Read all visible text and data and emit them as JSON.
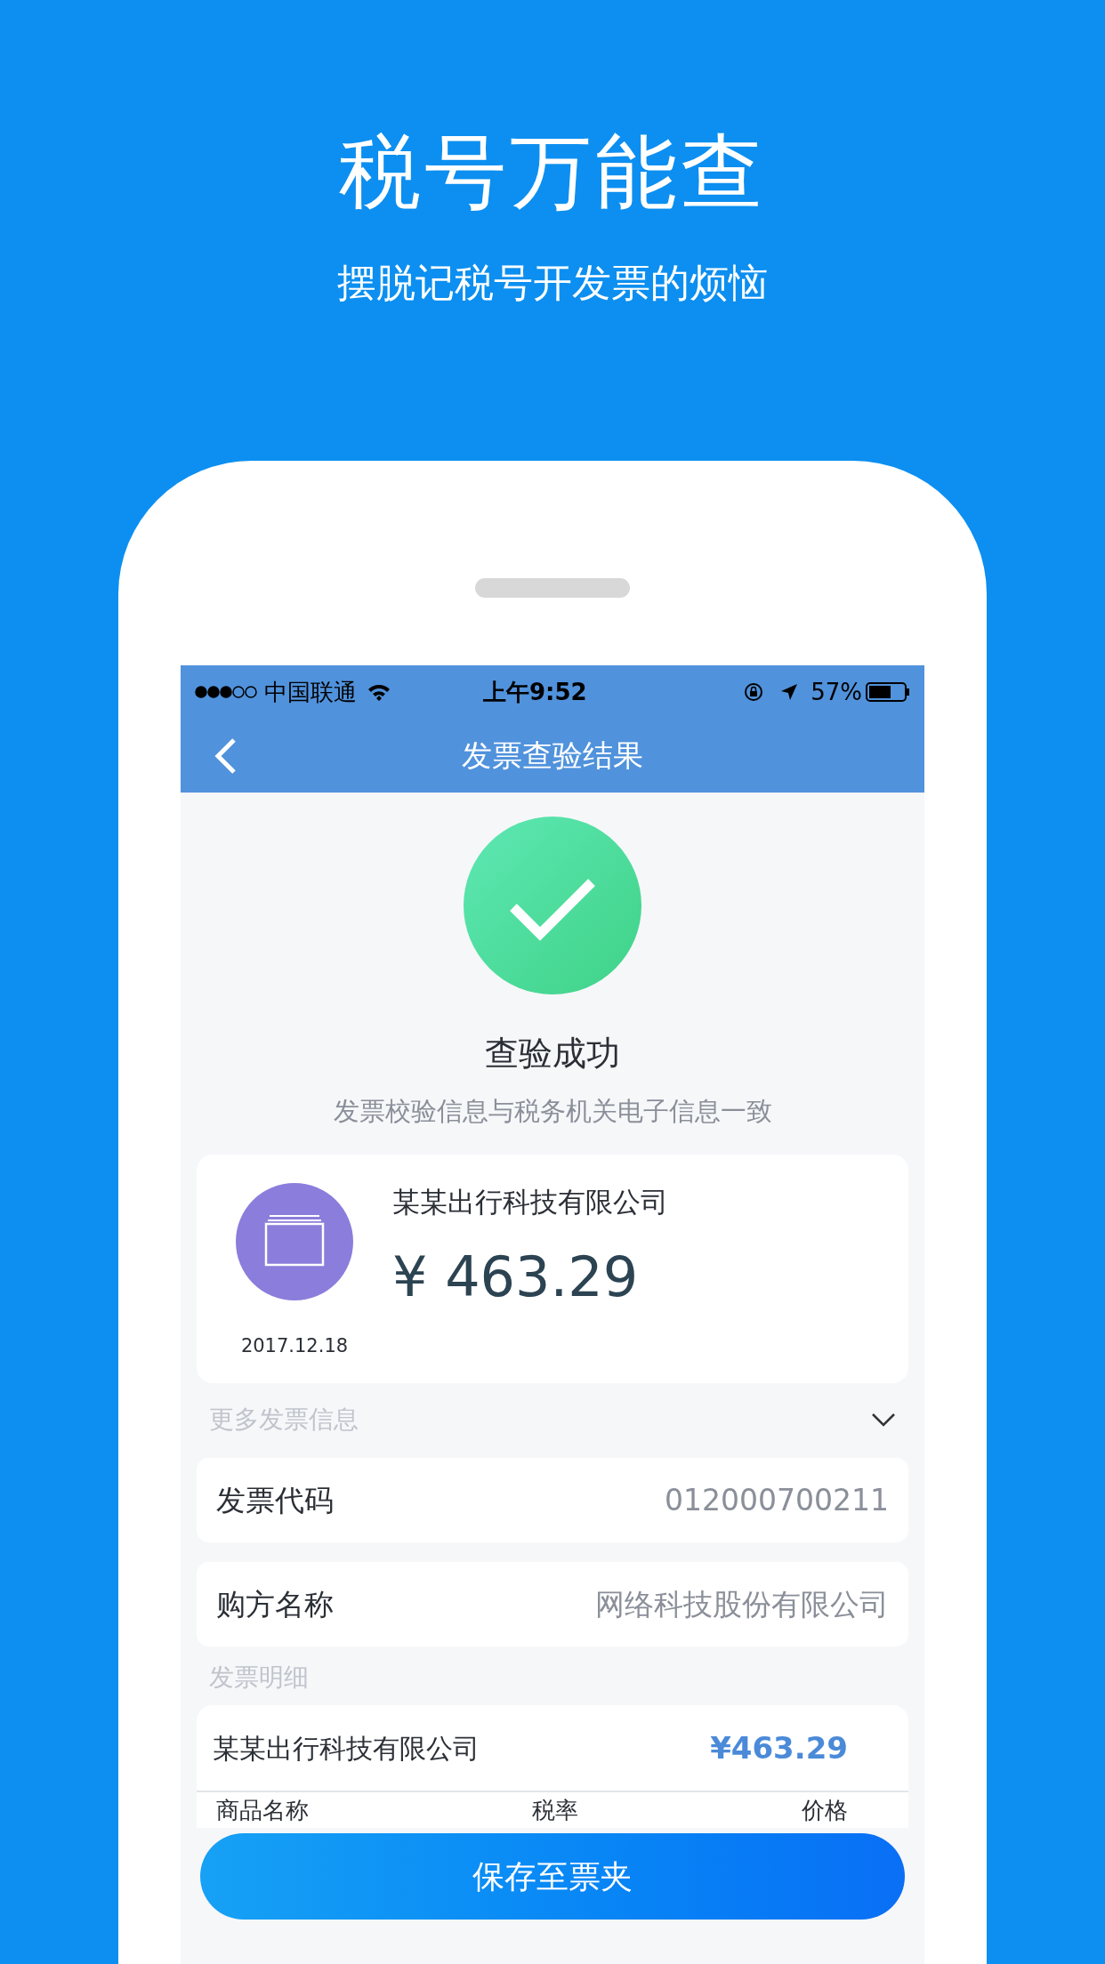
{
  "header": {
    "title": "税号万能查",
    "subtitle": "摆脱记税号开发票的烦恼"
  },
  "status_bar": {
    "carrier": "中国联通",
    "time": "上午9:52",
    "battery": "57%"
  },
  "nav": {
    "title": "发票查验结果"
  },
  "result": {
    "title": "查验成功",
    "message": "发票校验信息与税务机关电子信息一致"
  },
  "invoice_card": {
    "company": "某某出行科技有限公司",
    "amount": "¥ 463.29",
    "date": "2017.12.18"
  },
  "more_section": {
    "label": "更多发票信息"
  },
  "info_rows": [
    {
      "label": "发票代码",
      "value": "012000700211"
    },
    {
      "label": "购方名称",
      "value": "网络科技股份有限公司"
    }
  ],
  "detail_section": {
    "label": "发票明细"
  },
  "detail_card": {
    "company": "某某出行科技有限公司",
    "amount": "¥463.29",
    "columns": [
      "商品名称",
      "税率",
      "价格"
    ]
  },
  "save_button": "保存至票夹"
}
